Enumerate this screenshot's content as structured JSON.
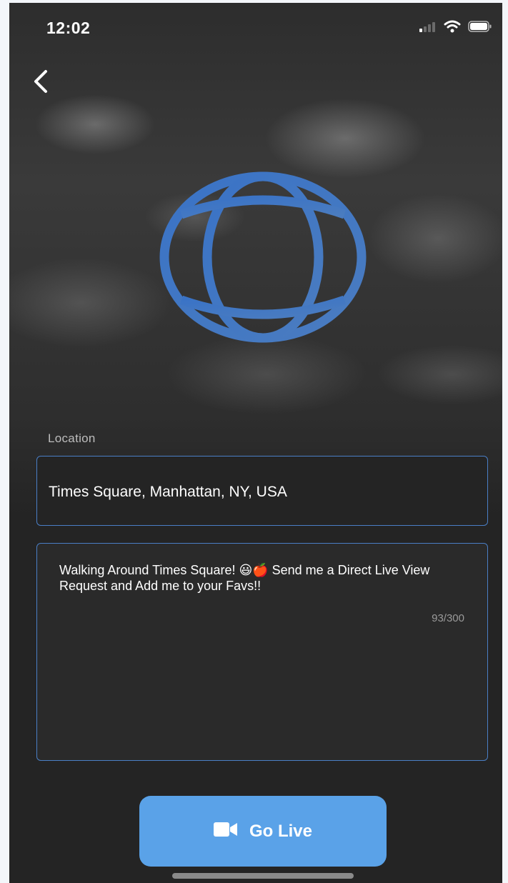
{
  "status_bar": {
    "time": "12:02",
    "icons": [
      "cellular-signal-icon",
      "wifi-icon",
      "battery-icon"
    ]
  },
  "nav": {
    "back_icon": "chevron-left-icon"
  },
  "hero": {
    "icon": "globe-icon",
    "icon_color": "#3f74c2"
  },
  "location": {
    "label": "Location",
    "value": "Times Square, Manhattan, NY, USA"
  },
  "description": {
    "value": "Walking Around Times Square! 😃🍎  Send me a Direct Live View Request and Add me to your Favs!!",
    "counter": "93/300"
  },
  "go_live": {
    "label": "Go Live",
    "icon": "video-camera-icon",
    "color": "#5aa2e8"
  },
  "colors": {
    "background": "#242424",
    "field_border": "#4a7fc6"
  }
}
